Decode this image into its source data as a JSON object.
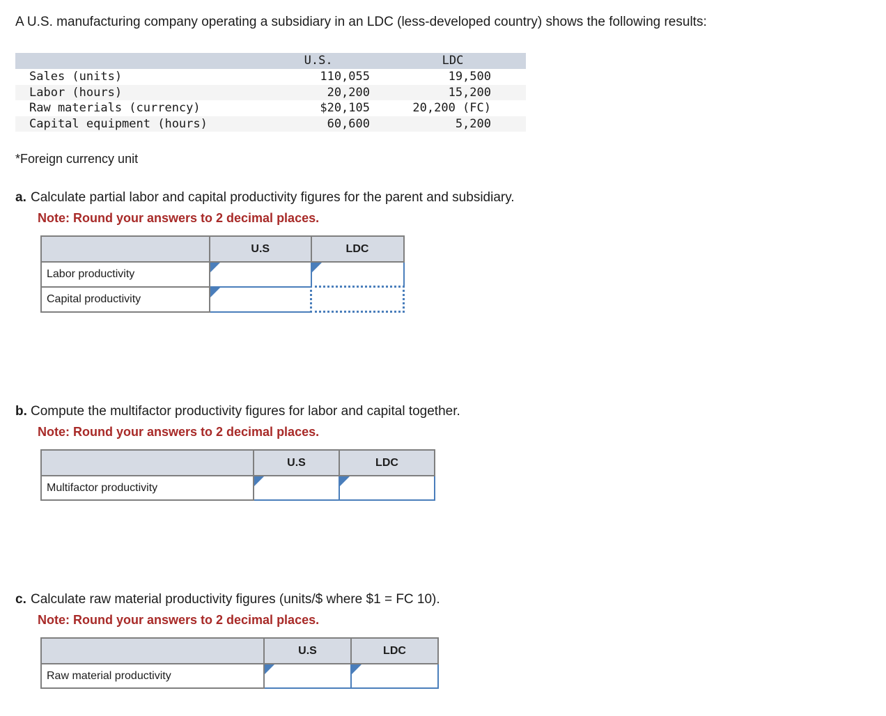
{
  "prompt": "A U.S. manufacturing company operating a subsidiary in an LDC (less-developed country) shows the following results:",
  "footnote": "*Foreign currency unit",
  "given_table": {
    "headers": [
      "",
      "U.S.",
      "LDC"
    ],
    "rows": [
      {
        "label": "Sales (units)",
        "us": "110,055",
        "ldc": "19,500"
      },
      {
        "label": "Labor (hours)",
        "us": "20,200",
        "ldc": "15,200"
      },
      {
        "label": "Raw materials (currency)",
        "us": "$20,105",
        "ldc": "20,200 (FC)"
      },
      {
        "label": "Capital equipment (hours)",
        "us": "60,600",
        "ldc": "5,200"
      }
    ]
  },
  "colors": {
    "given_header_bg": "#ced5e0",
    "given_shade_bg": "#f4f4f4",
    "answer_header_bg": "#d6dbe4",
    "answer_border": "#7f7f7f",
    "input_border": "#4a7ebb",
    "note_red": "#a82a28"
  },
  "questions": [
    {
      "letter": "a.",
      "text": "Calculate partial labor and capital productivity figures for the parent and subsidiary.",
      "note": "Note: Round your answers to 2 decimal places.",
      "table": {
        "headers": [
          "",
          "U.S",
          "LDC"
        ],
        "rows": [
          {
            "label": "Labor productivity",
            "us": "",
            "ldc": ""
          },
          {
            "label": "Capital productivity",
            "us": "",
            "ldc": ""
          }
        ]
      }
    },
    {
      "letter": "b.",
      "text": "Compute the multifactor productivity figures for labor and capital together.",
      "note": "Note: Round your answers to 2 decimal places.",
      "table": {
        "headers": [
          "",
          "U.S",
          "LDC"
        ],
        "rows": [
          {
            "label": "Multifactor productivity",
            "us": "",
            "ldc": ""
          }
        ]
      }
    },
    {
      "letter": "c.",
      "text": "Calculate raw material productivity figures (units/$ where $1 = FC 10).",
      "note": "Note: Round your answers to 2 decimal places.",
      "table": {
        "headers": [
          "",
          "U.S",
          "LDC"
        ],
        "rows": [
          {
            "label": "Raw material productivity",
            "us": "",
            "ldc": ""
          }
        ]
      }
    }
  ]
}
